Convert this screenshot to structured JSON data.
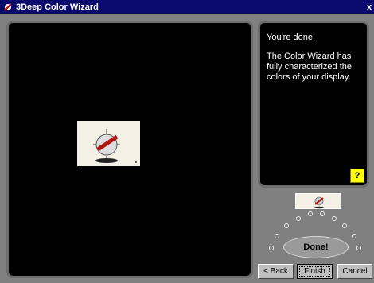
{
  "window": {
    "title": "3Deep Color Wizard",
    "close_label": "x"
  },
  "message": {
    "heading": "You're done!",
    "body": "The Color Wizard has fully characterized the colors of your display."
  },
  "help": {
    "label": "?"
  },
  "progress": {
    "done_label": "Done!"
  },
  "buttons": {
    "back": "< Back",
    "finish": "Finish",
    "cancel": "Cancel"
  },
  "colors": {
    "titlebar": "#0a0a6e",
    "panel": "#000000",
    "help_bg": "#ffff00"
  }
}
